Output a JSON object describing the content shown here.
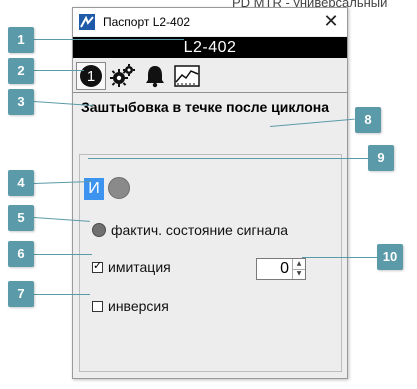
{
  "background_text": "PD MTR - универсальный",
  "window": {
    "title": "Паспорт L2-402",
    "close_glyph": "✕",
    "object_name": "L2-402"
  },
  "toolbar": {
    "tabs": [
      {
        "icon": "info-number-icon",
        "glyph": "1",
        "active": true
      },
      {
        "icon": "gears-icon",
        "active": false
      },
      {
        "icon": "bell-icon",
        "active": false
      },
      {
        "icon": "trend-icon",
        "active": false
      }
    ]
  },
  "object": {
    "title": "Заштыбовка в течке после циклона"
  },
  "panel": {
    "mode_label": "И",
    "signal_label": "фактич. состояние сигнала",
    "imitation_label": "имитация",
    "imitation_checked": true,
    "imitation_value": "0",
    "inversion_label": "инверсия",
    "inversion_checked": false,
    "checkmark": "✓",
    "spin_up": "▲",
    "spin_down": "▼"
  },
  "callouts": [
    "1",
    "2",
    "3",
    "4",
    "5",
    "6",
    "7",
    "8",
    "9",
    "10"
  ],
  "colors": {
    "callout": "#5b9aa8",
    "mode_active": "#3d93f0",
    "name_bar": "#000000",
    "lamp_gray": "#8a8a8a"
  }
}
